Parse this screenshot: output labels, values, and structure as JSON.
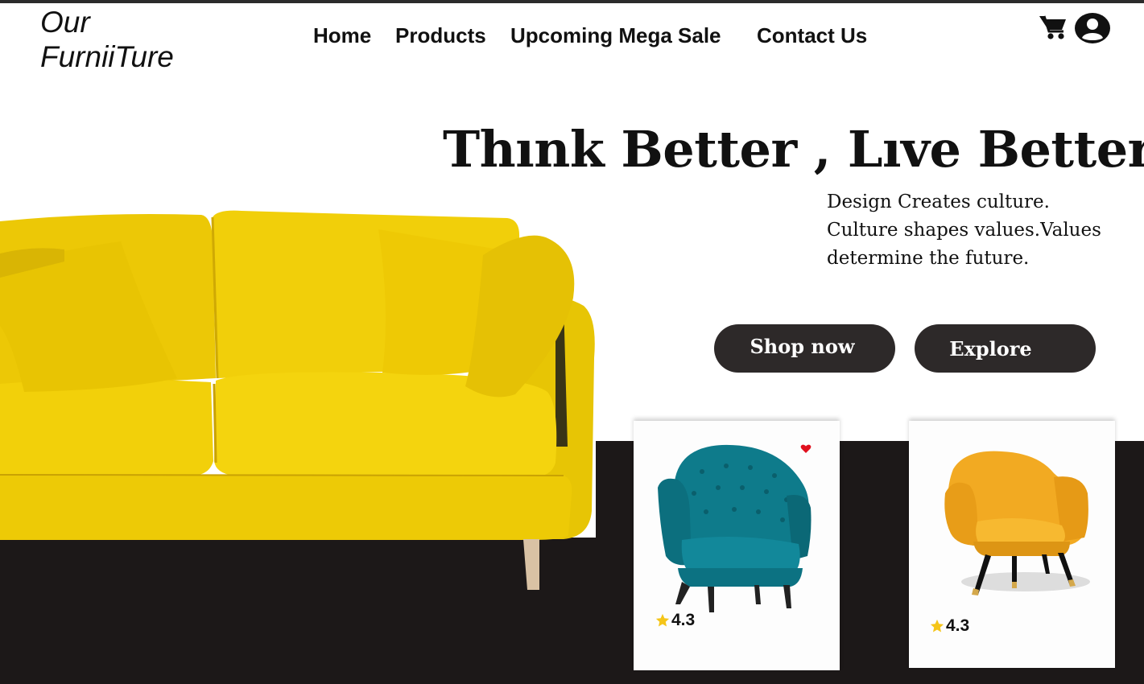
{
  "brand": {
    "logo_line1": "Our",
    "logo_line2": "FurniiTure"
  },
  "nav": {
    "items": [
      {
        "label": "Home"
      },
      {
        "label": "Products"
      },
      {
        "label": "Upcoming Mega Sale"
      },
      {
        "label": "Contact Us"
      }
    ]
  },
  "header_icons": [
    "cart-icon",
    "user-account-icon"
  ],
  "hero": {
    "headline": "Thınk Better , Lıve Better",
    "tagline_line1": "Design Creates culture.",
    "tagline_line2": "Culture shapes values.Values",
    "tagline_line3": "determine the future.",
    "shop_button": "Shop now",
    "explore_button": "Explore"
  },
  "products": [
    {
      "name_icon": "teal-armchair-image",
      "rating": "4.3",
      "favorite": true
    },
    {
      "name_icon": "yellow-armchair-image",
      "rating": "4.3",
      "favorite": false
    }
  ],
  "colors": {
    "dark": "#1c1818",
    "button": "#2d2929",
    "sofa_yellow": "#f2d00a",
    "star": "#f5c518",
    "heart": "#e0101e",
    "teal": "#0f7a8a",
    "mustard": "#f2aa22"
  }
}
